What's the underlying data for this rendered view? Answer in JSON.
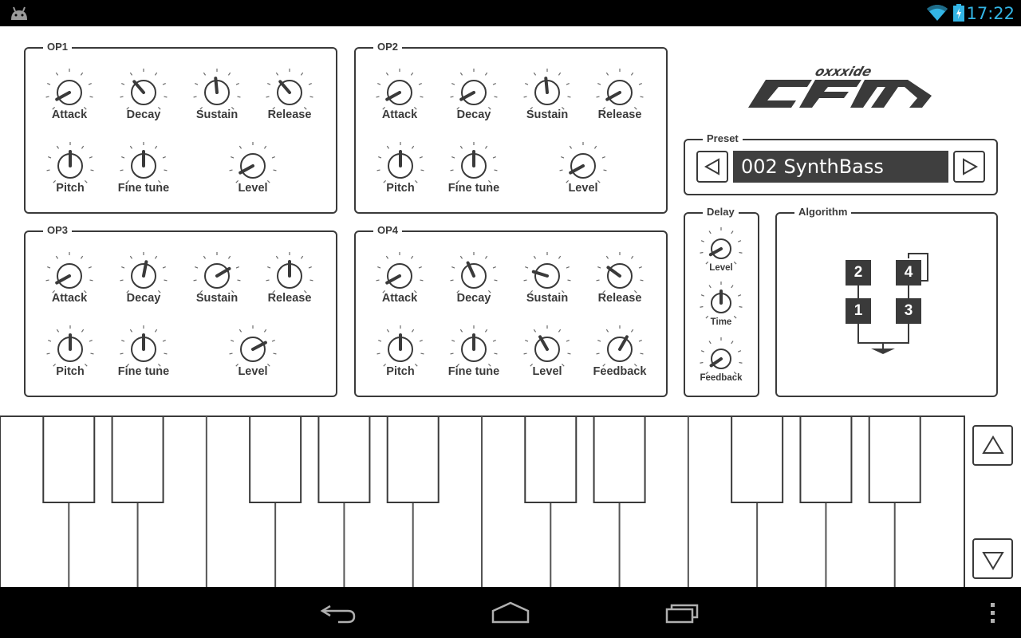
{
  "status_bar": {
    "time": "17:22",
    "icons": [
      "android-debug-icon",
      "wifi-icon",
      "battery-charging-icon"
    ],
    "accent_color": "#33b5e5"
  },
  "logo": {
    "brand": "oxxxide",
    "product": "CFM"
  },
  "operators": [
    {
      "title": "OP1",
      "knobs": [
        {
          "label": "Attack",
          "value": 0.06
        },
        {
          "label": "Decay",
          "value": 0.35
        },
        {
          "label": "Sustain",
          "value": 0.48
        },
        {
          "label": "Release",
          "value": 0.35
        },
        {
          "label": "Pitch",
          "value": 0.5
        },
        {
          "label": "Fine tune",
          "value": 0.5
        },
        {
          "label": "Level",
          "value": 0.06
        }
      ]
    },
    {
      "title": "OP2",
      "knobs": [
        {
          "label": "Attack",
          "value": 0.06
        },
        {
          "label": "Decay",
          "value": 0.06
        },
        {
          "label": "Sustain",
          "value": 0.48
        },
        {
          "label": "Release",
          "value": 0.06
        },
        {
          "label": "Pitch",
          "value": 0.5
        },
        {
          "label": "Fine tune",
          "value": 0.5
        },
        {
          "label": "Level",
          "value": 0.06
        }
      ]
    },
    {
      "title": "OP3",
      "knobs": [
        {
          "label": "Attack",
          "value": 0.06
        },
        {
          "label": "Decay",
          "value": 0.54
        },
        {
          "label": "Sustain",
          "value": 0.72
        },
        {
          "label": "Release",
          "value": 0.5
        },
        {
          "label": "Pitch",
          "value": 0.5
        },
        {
          "label": "Fine tune",
          "value": 0.5
        },
        {
          "label": "Level",
          "value": 0.73
        }
      ]
    },
    {
      "title": "OP4",
      "knobs": [
        {
          "label": "Attack",
          "value": 0.06
        },
        {
          "label": "Decay",
          "value": 0.41
        },
        {
          "label": "Sustain",
          "value": 0.23
        },
        {
          "label": "Release",
          "value": 0.3
        },
        {
          "label": "Pitch",
          "value": 0.5
        },
        {
          "label": "Fine tune",
          "value": 0.5
        },
        {
          "label": "Level",
          "value": 0.39
        },
        {
          "label": "Feedback",
          "value": 0.61
        }
      ]
    }
  ],
  "preset": {
    "title": "Preset",
    "current": "002 SynthBass",
    "prev_icon": "triangle-left-icon",
    "next_icon": "triangle-right-icon"
  },
  "delay": {
    "title": "Delay",
    "knobs": [
      {
        "label": "Level",
        "value": 0.06
      },
      {
        "label": "Time",
        "value": 0.5
      },
      {
        "label": "Feedback",
        "value": 0.04
      }
    ]
  },
  "algorithm": {
    "title": "Algorithm",
    "operators": [
      "2",
      "4",
      "1",
      "3"
    ],
    "connections": [
      [
        "2",
        "1"
      ],
      [
        "4",
        "3"
      ],
      [
        "4",
        "4"
      ]
    ],
    "output_icon": "output-arrow-icon"
  },
  "keyboard": {
    "white_keys": [
      "C",
      "D",
      "E",
      "F",
      "G",
      "A",
      "B",
      "C",
      "D",
      "E",
      "F",
      "G",
      "A",
      "B"
    ],
    "black_keys": [
      "C#",
      "D#",
      "F#",
      "G#",
      "A#",
      "C#",
      "D#",
      "F#",
      "G#",
      "A#"
    ],
    "octave_up_icon": "triangle-up-icon",
    "octave_down_icon": "triangle-down-icon"
  },
  "nav_bar": {
    "icons": [
      "back-icon",
      "home-icon",
      "recent-apps-icon",
      "overflow-menu-icon"
    ]
  }
}
